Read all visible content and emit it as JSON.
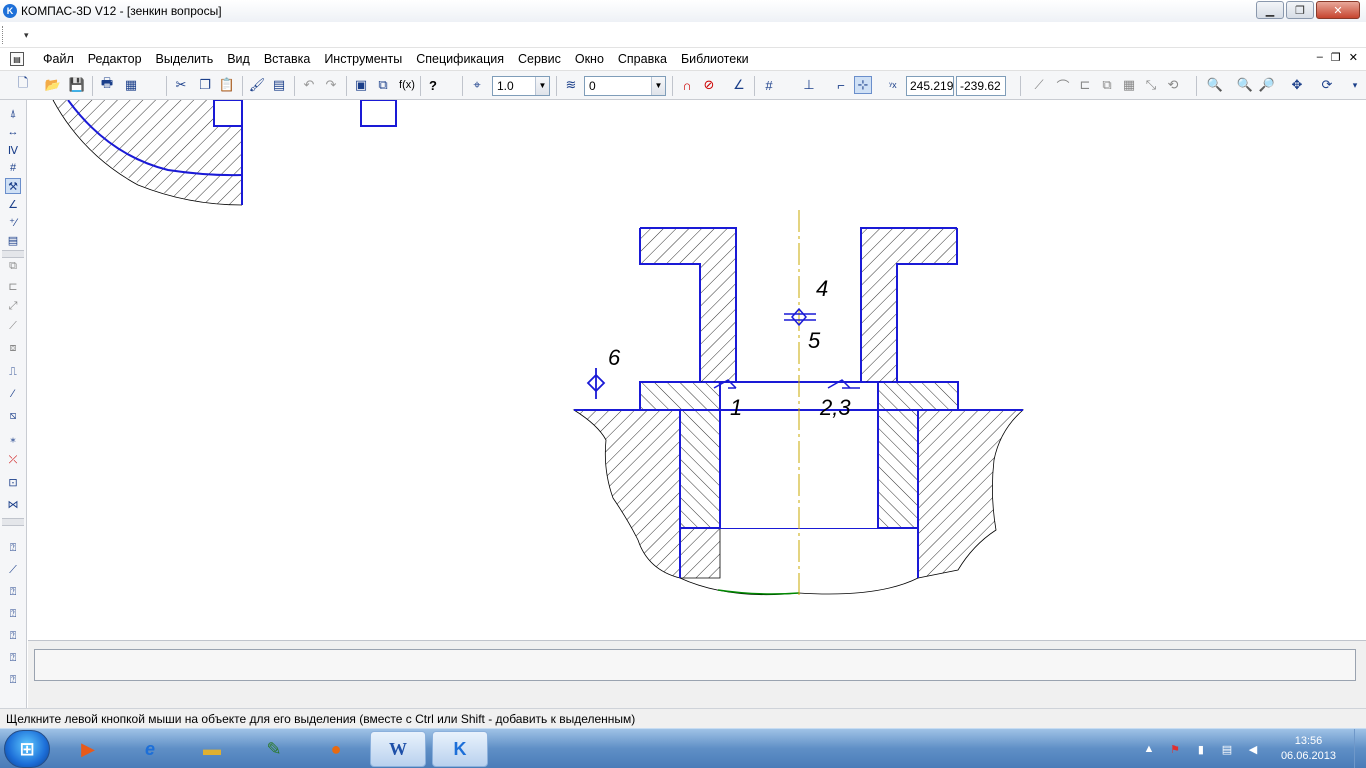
{
  "window": {
    "title": "КОМПАС-3D V12 - [зенкин вопросы]",
    "app_icon_letter": "K",
    "minimize": "▁",
    "maximize": "❐",
    "close": "✕"
  },
  "menu": {
    "items": [
      "Файл",
      "Редактор",
      "Выделить",
      "Вид",
      "Вставка",
      "Инструменты",
      "Спецификация",
      "Сервис",
      "Окно",
      "Справка",
      "Библиотеки"
    ],
    "mdi_minimize": "–",
    "mdi_restore": "❐",
    "mdi_close": "✕"
  },
  "toolbar": {
    "step_value": "1.0",
    "layer_value": "0",
    "coord_x": "245.219",
    "coord_y": "-239.62",
    "icons": [
      "new-document-icon",
      "open-folder-icon",
      "save-icon",
      "print-icon",
      "cut-icon",
      "copy-icon",
      "paste-icon",
      "format-brush-icon",
      "properties-icon",
      "undo-icon",
      "redo-icon",
      "manager-icon",
      "variables-icon",
      "function-icon",
      "help-cursor-icon",
      "step-icon",
      "layer-icon",
      "snap-magnet-icon",
      "grid-icon",
      "local-cs-icon",
      "ortho-icon",
      "round-icon",
      "zoom-icon",
      "pan-icon"
    ],
    "fx_label": "f(x)",
    "help_label": "?"
  },
  "drawing": {
    "labels": {
      "l1": "1",
      "l23": "2,3",
      "l4": "4",
      "l5": "5",
      "l6": "6"
    },
    "line_color": "#1a1ad6",
    "axis_color": "#c8a800",
    "edge_color": "#008800"
  },
  "status": {
    "text": "Щелкните левой кнопкой мыши на объекте для его выделения (вместе с Ctrl или Shift - добавить к выделенным)"
  },
  "taskbar": {
    "start_label": "⊞",
    "apps": [
      "media-player-icon",
      "internet-explorer-icon",
      "explorer-folder-icon",
      "paint-icon",
      "firefox-icon",
      "word-icon",
      "kompas-icon"
    ],
    "word_label": "W",
    "kompas_label": "K",
    "time": "13:56",
    "date": "06.06.2013"
  }
}
